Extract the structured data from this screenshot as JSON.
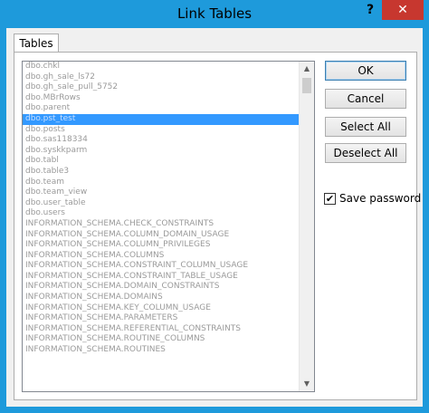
{
  "window": {
    "title": "Link Tables",
    "help_glyph": "?",
    "close_glyph": "✕"
  },
  "tab": {
    "label": "Tables"
  },
  "list": {
    "items": [
      "dbo.chkl",
      "dbo.gh_sale_ls72",
      "dbo.gh_sale_pull_5752",
      "dbo.MBrRows",
      "dbo.parent",
      "dbo.pst_test",
      "dbo.posts",
      "dbo.sas118334",
      "dbo.syskkparm",
      "dbo.tabl",
      "dbo.table3",
      "dbo.team",
      "dbo.team_view",
      "dbo.user_table",
      "dbo.users",
      "INFORMATION_SCHEMA.CHECK_CONSTRAINTS",
      "INFORMATION_SCHEMA.COLUMN_DOMAIN_USAGE",
      "INFORMATION_SCHEMA.COLUMN_PRIVILEGES",
      "INFORMATION_SCHEMA.COLUMNS",
      "INFORMATION_SCHEMA.CONSTRAINT_COLUMN_USAGE",
      "INFORMATION_SCHEMA.CONSTRAINT_TABLE_USAGE",
      "INFORMATION_SCHEMA.DOMAIN_CONSTRAINTS",
      "INFORMATION_SCHEMA.DOMAINS",
      "INFORMATION_SCHEMA.KEY_COLUMN_USAGE",
      "INFORMATION_SCHEMA.PARAMETERS",
      "INFORMATION_SCHEMA.REFERENTIAL_CONSTRAINTS",
      "INFORMATION_SCHEMA.ROUTINE_COLUMNS",
      "INFORMATION_SCHEMA.ROUTINES"
    ],
    "selected_index": 5
  },
  "buttons": {
    "ok": "OK",
    "cancel": "Cancel",
    "select_all": "Select All",
    "deselect_all": "Deselect All"
  },
  "save_password": {
    "label": "Save password",
    "checked": true,
    "check_glyph": "✔"
  },
  "colors": {
    "titlebar": "#1e9adb",
    "close": "#c7372f",
    "selection": "#3399ff"
  },
  "icons": {
    "scroll_up": "▲",
    "scroll_down": "▼"
  }
}
